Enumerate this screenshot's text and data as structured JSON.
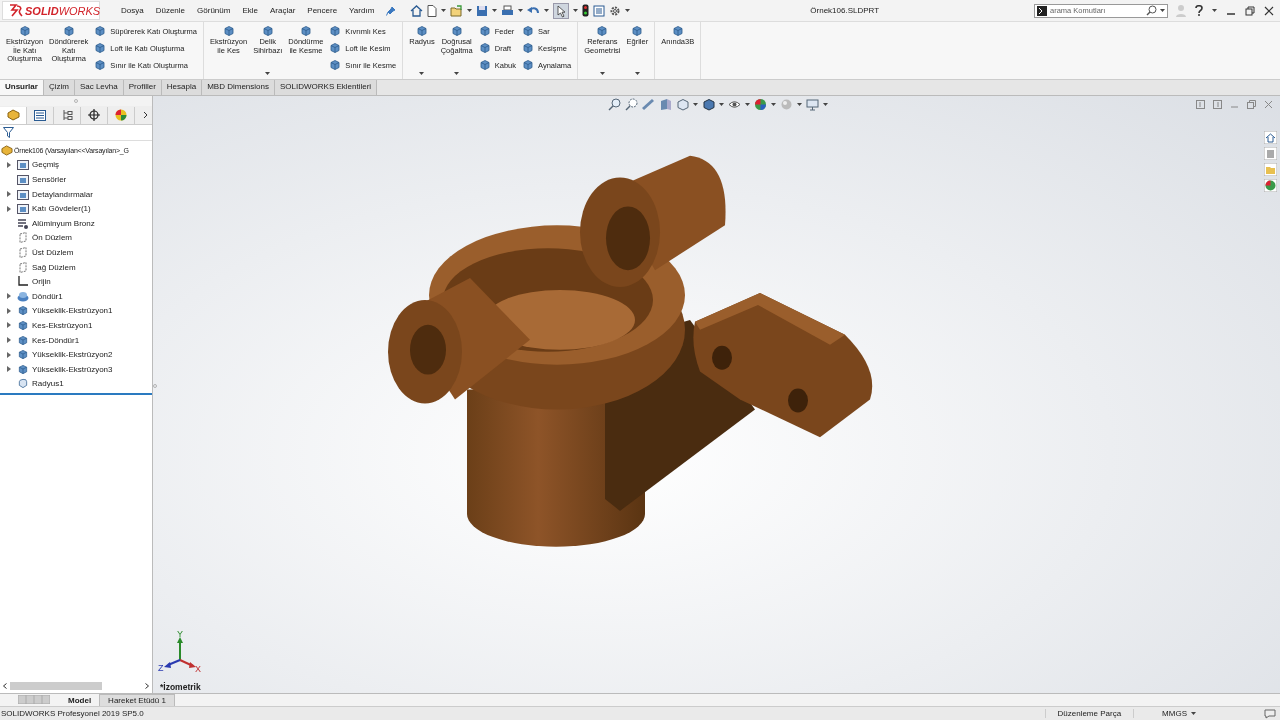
{
  "logo": "**SOLID**WORKS",
  "menu": [
    {
      "label": "Dosya"
    },
    {
      "label": "Düzenle"
    },
    {
      "label": "Görünüm"
    },
    {
      "label": "Ekle"
    },
    {
      "label": "Araçlar"
    },
    {
      "label": "Pencere"
    },
    {
      "label": "Yardım"
    }
  ],
  "document_title": "Örnek106.SLDPRT",
  "search": {
    "placeholder": "arama Komutları"
  },
  "ribbon": {
    "groups": [
      {
        "items": [
          {
            "kind": "large",
            "label": "Ekstrüzyon\nİle Katı\nOluşturma",
            "caret": false
          },
          {
            "kind": "large",
            "label": "Döndürerek\nKatı\nOluşturma",
            "caret": false
          },
          {
            "kind": "column",
            "items": [
              {
                "label": "Süpürerek Katı Oluşturma"
              },
              {
                "label": "Loft ile Katı Oluşturma"
              },
              {
                "label": "Sınır ile Katı Oluşturma"
              }
            ]
          }
        ]
      },
      {
        "items": [
          {
            "kind": "large",
            "label": "Ekstrüzyon\nile Kes",
            "caret": false
          },
          {
            "kind": "large",
            "label": "Delik\nSihirbazı",
            "caret": true
          },
          {
            "kind": "large",
            "label": "Döndürme\nile Kesme",
            "caret": false
          },
          {
            "kind": "column",
            "items": [
              {
                "label": "Kıvrımlı Kes"
              },
              {
                "label": "Loft ile Kesim"
              },
              {
                "label": "Sınır ile Kesme"
              }
            ]
          }
        ]
      },
      {
        "items": [
          {
            "kind": "large",
            "label": "Radyus",
            "caret": true
          },
          {
            "kind": "large",
            "label": "Doğrusal\nÇoğaltma",
            "caret": true
          },
          {
            "kind": "column",
            "items": [
              {
                "label": "Feder"
              },
              {
                "label": "Draft"
              },
              {
                "label": "Kabuk"
              }
            ]
          },
          {
            "kind": "column",
            "items": [
              {
                "label": "Sar"
              },
              {
                "label": "Kesişme"
              },
              {
                "label": "Aynalama"
              }
            ]
          }
        ]
      },
      {
        "items": [
          {
            "kind": "large",
            "label": "Referans\nGeometrisi",
            "caret": true
          },
          {
            "kind": "large",
            "label": "Eğriler",
            "caret": true
          }
        ]
      },
      {
        "items": [
          {
            "kind": "large",
            "label": "Anında3B",
            "caret": false
          }
        ]
      }
    ]
  },
  "ribbon_tabs": [
    {
      "label": "Unsurlar",
      "selected": true
    },
    {
      "label": "Çizim",
      "selected": false
    },
    {
      "label": "Sac Levha",
      "selected": false
    },
    {
      "label": "Profiller",
      "selected": false
    },
    {
      "label": "Hesapla",
      "selected": false
    },
    {
      "label": "MBD Dimensions",
      "selected": false
    },
    {
      "label": "SOLIDWORKS Eklentileri",
      "selected": false
    }
  ],
  "panel_tabs": [
    {
      "selected": true
    },
    {
      "selected": false
    },
    {
      "selected": false
    },
    {
      "selected": false
    },
    {
      "selected": false
    }
  ],
  "feature_tree": {
    "root": "Örnek106  (Varsayılan<<Varsayılan>_G",
    "items": [
      {
        "label": "Geçmiş",
        "kind": "folder",
        "expandable": true
      },
      {
        "label": "Sensörler",
        "kind": "folder",
        "expandable": false
      },
      {
        "label": "Detaylandırmalar",
        "kind": "folder",
        "expandable": true
      },
      {
        "label": "Katı Gövdeler(1)",
        "kind": "folder",
        "expandable": true
      },
      {
        "label": "Alüminyum Bronz",
        "kind": "material",
        "expandable": false
      },
      {
        "label": "Ön Düzlem",
        "kind": "plane",
        "expandable": false
      },
      {
        "label": "Üst Düzlem",
        "kind": "plane",
        "expandable": false
      },
      {
        "label": "Sağ Düzlem",
        "kind": "plane",
        "expandable": false
      },
      {
        "label": "Orijin",
        "kind": "origin",
        "expandable": false
      },
      {
        "label": "Döndür1",
        "kind": "revolve",
        "expandable": true
      },
      {
        "label": "Yükseklik-Ekstrüzyon1",
        "kind": "feature",
        "expandable": true
      },
      {
        "label": "Kes-Ekstrüzyon1",
        "kind": "feature",
        "expandable": true
      },
      {
        "label": "Kes-Döndür1",
        "kind": "feature",
        "expandable": true
      },
      {
        "label": "Yükseklik-Ekstrüzyon2",
        "kind": "feature",
        "expandable": true
      },
      {
        "label": "Yükseklik-Ekstrüzyon3",
        "kind": "feature",
        "expandable": true
      },
      {
        "label": "Radyus1",
        "kind": "fillet",
        "expandable": false
      }
    ]
  },
  "triad": {
    "x": "X",
    "y": "Y",
    "z": "Z"
  },
  "view_label": "*İzometrik",
  "bottom_tabs": [
    {
      "label": "Model",
      "selected": true
    },
    {
      "label": "Hareket Etüdü 1",
      "selected": false
    }
  ],
  "status_bar": {
    "product": "SOLIDWORKS Profesyonel 2019 SP5.0",
    "mode": "Düzenleme Parça",
    "units": "MMGS"
  }
}
